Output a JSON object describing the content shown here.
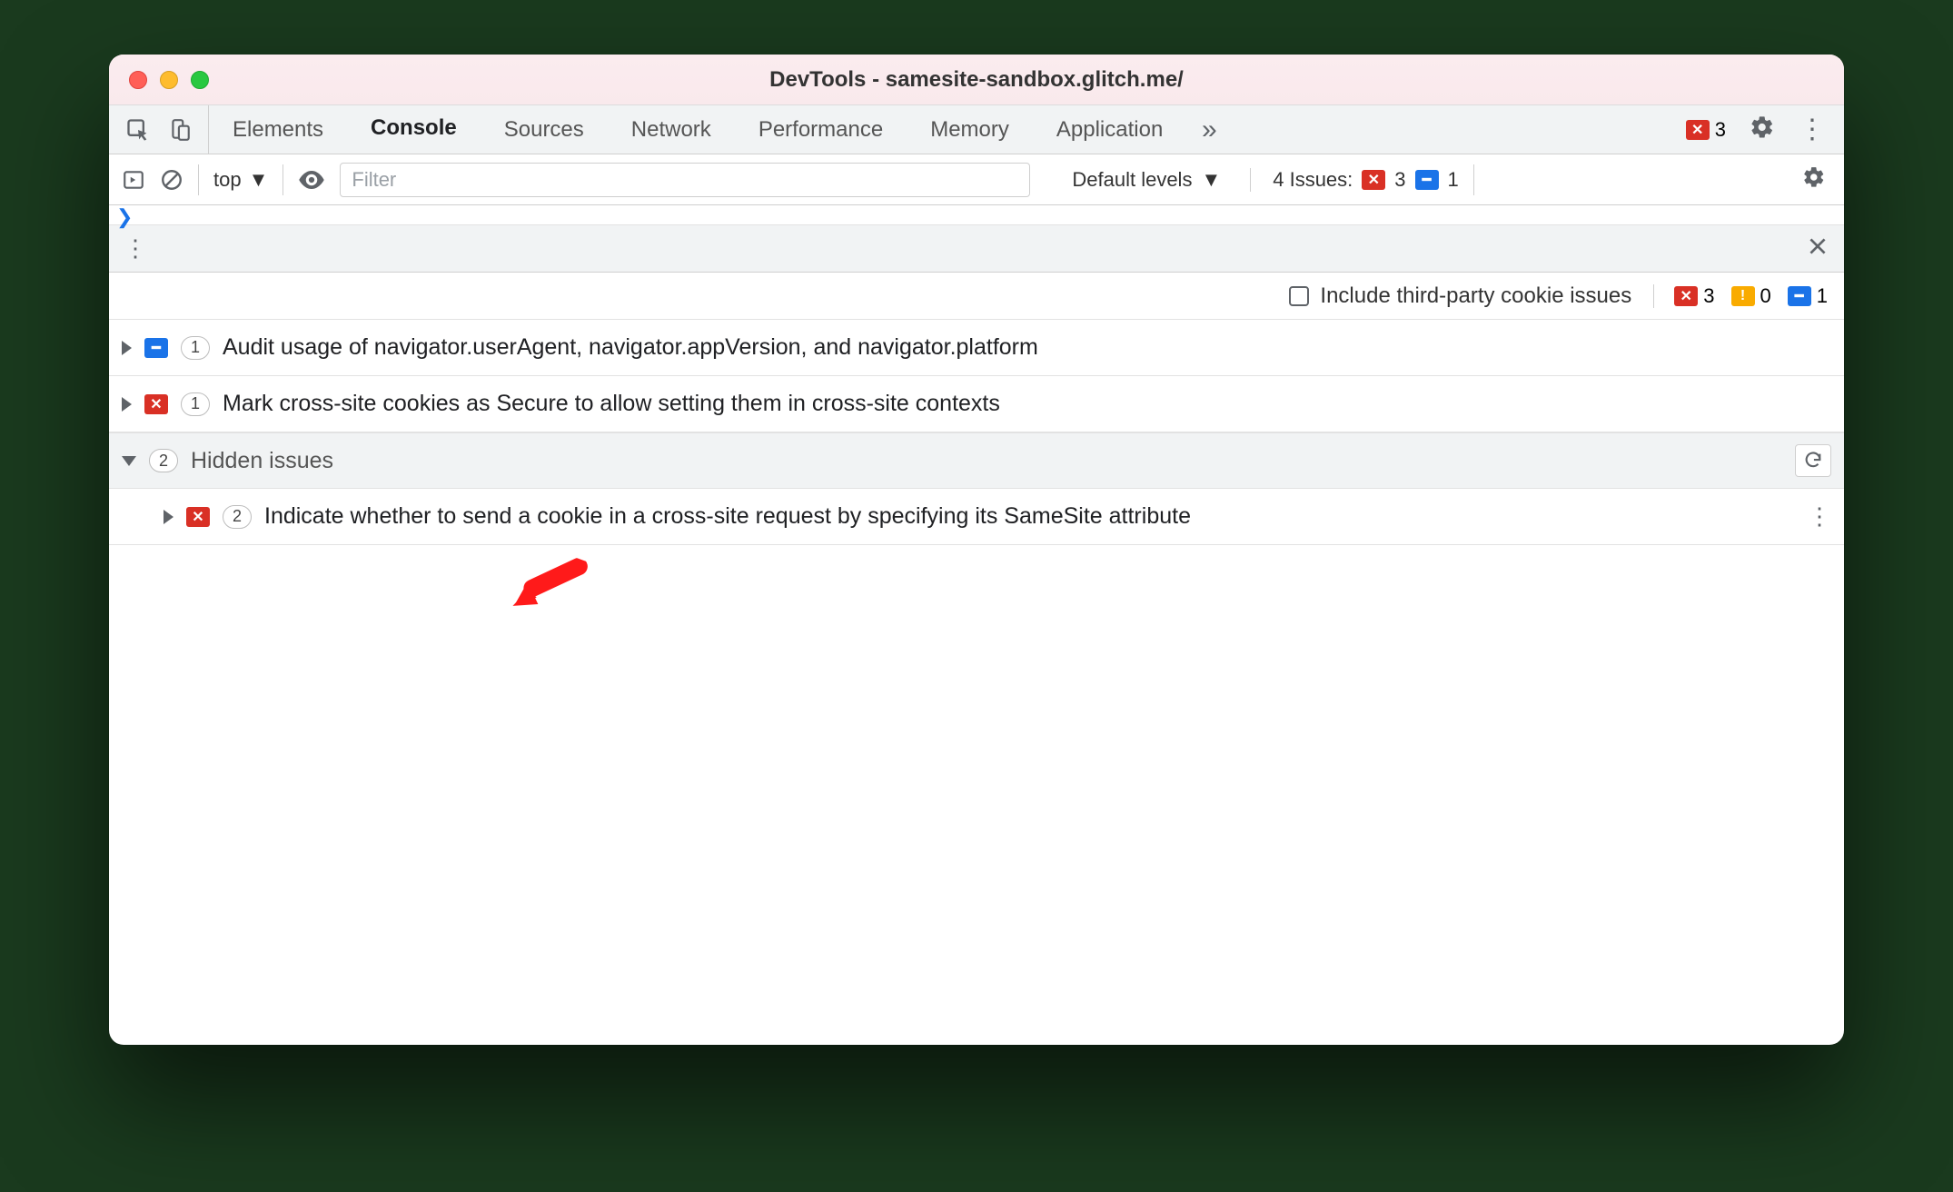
{
  "window": {
    "title": "DevTools - samesite-sandbox.glitch.me/"
  },
  "tabs": {
    "items": [
      "Elements",
      "Console",
      "Sources",
      "Network",
      "Performance",
      "Memory",
      "Application"
    ],
    "active": "Console",
    "overflow_glyph": "»"
  },
  "tabbar_right": {
    "error_count": "3"
  },
  "console_toolbar": {
    "context": "top",
    "filter_placeholder": "Filter",
    "levels_label": "Default levels",
    "issues_label": "4 Issues:",
    "issues_error": "3",
    "issues_info": "1"
  },
  "issues_filter": {
    "checkbox_label": "Include third-party cookie issues",
    "counts": {
      "error": "3",
      "warning": "0",
      "info": "1"
    }
  },
  "issues": [
    {
      "kind": "info",
      "count": "1",
      "title": "Audit usage of navigator.userAgent, navigator.appVersion, and navigator.platform"
    },
    {
      "kind": "error",
      "count": "1",
      "title": "Mark cross-site cookies as Secure to allow setting them in cross-site contexts"
    }
  ],
  "hidden_section": {
    "count": "2",
    "label": "Hidden issues"
  },
  "hidden_issues": [
    {
      "kind": "error",
      "count": "2",
      "title": "Indicate whether to send a cookie in a cross-site request by specifying its SameSite attribute"
    }
  ]
}
